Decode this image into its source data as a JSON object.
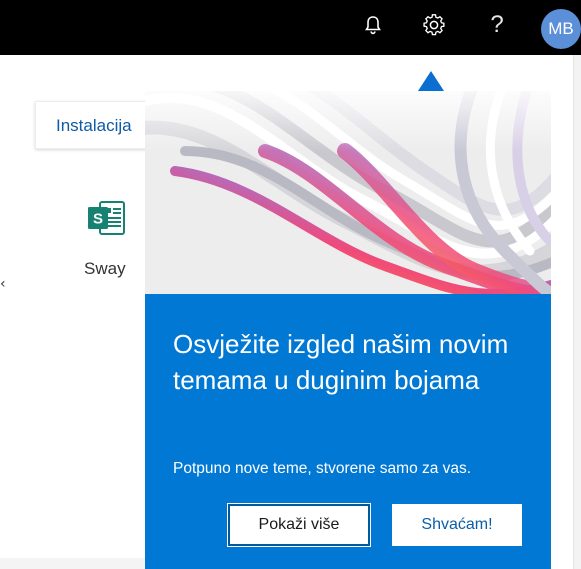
{
  "header": {
    "icons": [
      "bell-icon",
      "gear-icon",
      "help-icon"
    ],
    "help_glyph": "?",
    "avatar_initials": "MB",
    "avatar_color": "#5b8fd8"
  },
  "page": {
    "install_label": "Instalacija",
    "apps": [
      {
        "name": "Sway",
        "icon": "sway-icon",
        "color": "#188272"
      }
    ],
    "left_arrow": "‹"
  },
  "popover": {
    "title": "Osvježite izgled našim novim temama u duginim bojama",
    "description": "Potpuno nove teme, stvorene samo za vas.",
    "primary_button": "Pokaži više",
    "secondary_button": "Shvaćam!",
    "background_color": "#0078d4"
  }
}
